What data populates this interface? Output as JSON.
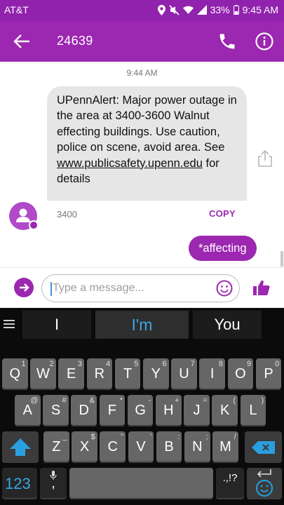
{
  "status_bar": {
    "carrier": "AT&T",
    "battery": "33%",
    "time": "9:45 AM",
    "icons": [
      "location-icon",
      "mute-icon",
      "wifi-icon",
      "signal-icon",
      "battery-icon"
    ]
  },
  "toolbar": {
    "title": "24639",
    "icons": [
      "back-arrow-icon",
      "phone-icon",
      "info-icon"
    ]
  },
  "conversation": {
    "timestamp": "9:44 AM",
    "incoming": {
      "text_before": "UPennAlert: Major power outage in the area at 3400-3600 Walnut effecting buildings. Use caution, police on scene, avoid area. See ",
      "link": "www.publicsafety.upenn.edu",
      "text_after": " for details",
      "code": "3400",
      "copy_label": "COPY"
    },
    "outgoing": {
      "text": "*affecting"
    }
  },
  "compose": {
    "placeholder": "Type a message...",
    "icons": [
      "attach-arrow-icon",
      "emoji-icon",
      "thumbs-up-icon"
    ]
  },
  "keyboard": {
    "suggestions": [
      "I",
      "I'm",
      "You"
    ],
    "row1": [
      {
        "k": "Q",
        "s": "1"
      },
      {
        "k": "W",
        "s": "2"
      },
      {
        "k": "E",
        "s": "3"
      },
      {
        "k": "R",
        "s": "4"
      },
      {
        "k": "T",
        "s": "5"
      },
      {
        "k": "Y",
        "s": "6"
      },
      {
        "k": "U",
        "s": "7"
      },
      {
        "k": "I",
        "s": "8"
      },
      {
        "k": "O",
        "s": "9"
      },
      {
        "k": "P",
        "s": "0"
      }
    ],
    "row2": [
      {
        "k": "A",
        "s": "@"
      },
      {
        "k": "S",
        "s": "#"
      },
      {
        "k": "D",
        "s": "&"
      },
      {
        "k": "F",
        "s": "*"
      },
      {
        "k": "G",
        "s": "-"
      },
      {
        "k": "H",
        "s": "+"
      },
      {
        "k": "J",
        "s": "="
      },
      {
        "k": "K",
        "s": "("
      },
      {
        "k": "L",
        "s": ")"
      }
    ],
    "row3": [
      {
        "k": "Z",
        "s": "_"
      },
      {
        "k": "X",
        "s": "$"
      },
      {
        "k": "C",
        "s": "\""
      },
      {
        "k": "V",
        "s": "'"
      },
      {
        "k": "B",
        "s": ":"
      },
      {
        "k": "N",
        "s": ";"
      },
      {
        "k": "M",
        "s": "/"
      }
    ],
    "numbers_label": "123",
    "comma": ",",
    "period_key": ".,!?"
  }
}
